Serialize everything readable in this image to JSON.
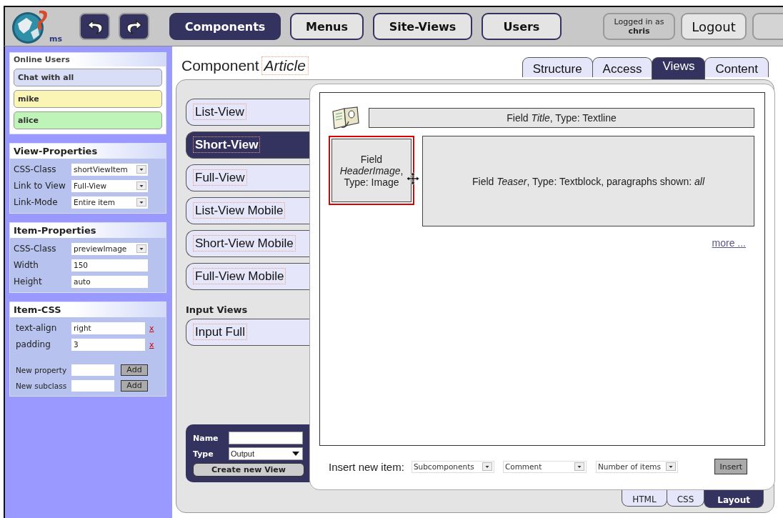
{
  "top_bar": {
    "logo_text": "ms",
    "nav_tabs": [
      {
        "label": "Components",
        "selected": true
      },
      {
        "label": "Menus",
        "selected": false
      },
      {
        "label": "Site-Views",
        "selected": false
      },
      {
        "label": "Users",
        "selected": false
      }
    ],
    "login": {
      "caption": "Logged in as",
      "user": "chris"
    },
    "logout_button": "Logout"
  },
  "sidebar": {
    "online_users": {
      "title": "Online Users",
      "items": [
        {
          "label": "Chat with all",
          "color": "#d8def6"
        },
        {
          "label": "mike",
          "color": "#fbf5b5"
        },
        {
          "label": "alice",
          "color": "#bff4b8"
        }
      ]
    },
    "view_properties": {
      "title": "View-Properties",
      "rows": [
        {
          "label": "CSS-Class",
          "value": "shortViewItem",
          "kind": "select"
        },
        {
          "label": "Link to View",
          "value": "Full-View",
          "kind": "select"
        },
        {
          "label": "Link-Mode",
          "value": "Entire item",
          "kind": "select"
        }
      ]
    },
    "item_properties": {
      "title": "Item-Properties",
      "rows": [
        {
          "label": "CSS-Class",
          "value": "previewImage",
          "kind": "select"
        },
        {
          "label": "Width",
          "value": "150",
          "kind": "input"
        },
        {
          "label": "Height",
          "value": "auto",
          "kind": "input"
        }
      ]
    },
    "item_css": {
      "title": "Item-CSS",
      "rows": [
        {
          "property": "text-align",
          "value": "right",
          "remove": "x"
        },
        {
          "property": "padding",
          "value": "3",
          "remove": "x"
        }
      ],
      "new_rows": [
        {
          "label": "New property",
          "button": "Add"
        },
        {
          "label": "New subclass",
          "button": "Add"
        }
      ]
    }
  },
  "page_title": {
    "prefix": "Component",
    "name": "Article"
  },
  "tabs": [
    {
      "label": "Structure",
      "selected": false
    },
    {
      "label": "Access",
      "selected": false
    },
    {
      "label": "Views",
      "selected": true
    },
    {
      "label": "Content",
      "selected": false
    }
  ],
  "views": [
    {
      "label": "List-View",
      "selected": false
    },
    {
      "label": "Short-View",
      "selected": true
    },
    {
      "label": "Full-View",
      "selected": false
    },
    {
      "label": "List-View Mobile",
      "selected": false
    },
    {
      "label": "Short-View Mobile",
      "selected": false
    },
    {
      "label": "Full-View Mobile",
      "selected": false
    }
  ],
  "input_views": {
    "title": "Input Views",
    "items": [
      {
        "label": "Input Full",
        "selected": false
      }
    ]
  },
  "create_form": {
    "name_label": "Name",
    "type_label": "Type",
    "type_value": "Output",
    "button": "Create new View"
  },
  "layout_editor": {
    "fields": [
      {
        "kind": "line",
        "text": "Field *Title*, Type: Textline",
        "selected": false
      },
      {
        "kind": "box",
        "text": "Field *HeaderImage*, Type: Image",
        "selected": true
      },
      {
        "kind": "block",
        "text": "Field *Teaser*, Type: Textblock, paragraphs shown: *all*",
        "selected": false
      }
    ],
    "more_link": "more ...",
    "insert": {
      "label": "Insert new item:",
      "selects": [
        "Subcomponents",
        "Comment",
        "Number of items"
      ],
      "button": "Insert"
    }
  },
  "bottom_tabs": [
    {
      "label": "HTML",
      "selected": false
    },
    {
      "label": "CSS",
      "selected": false
    },
    {
      "label": "Layout",
      "selected": true
    }
  ]
}
